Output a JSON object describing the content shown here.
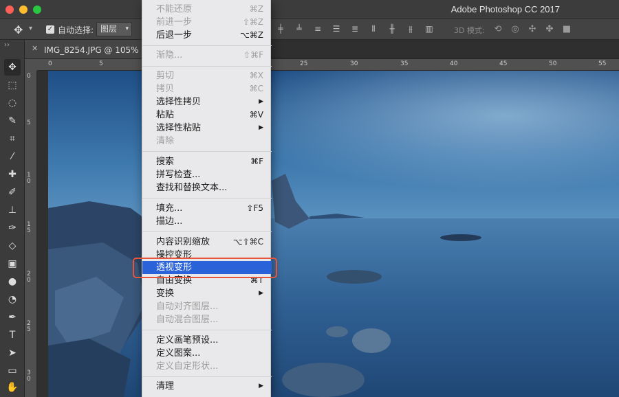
{
  "window": {
    "app_title": "Adobe Photoshop CC 2017"
  },
  "options_bar": {
    "auto_select_label": "自动选择:",
    "auto_select_target": "图层",
    "mode_3d_label": "3D 模式:"
  },
  "document": {
    "tab_name": "IMG_8254.JPG @ 105% (图"
  },
  "rulers": {
    "top_ticks": [
      "0",
      "5",
      "25",
      "30",
      "35",
      "40",
      "45",
      "50",
      "55"
    ],
    "left_ticks": [
      "0",
      "5",
      "1\n0",
      "1\n5",
      "2\n0",
      "2\n5",
      "3\n0"
    ]
  },
  "edit_menu": {
    "items": [
      {
        "label": "不能还原",
        "shortcut": "⌘Z",
        "disabled": true
      },
      {
        "label": "前进一步",
        "shortcut": "⇧⌘Z",
        "disabled": true
      },
      {
        "label": "后退一步",
        "shortcut": "⌥⌘Z",
        "disabled": false
      },
      {
        "label": "渐隐...",
        "shortcut": "⇧⌘F",
        "disabled": true
      },
      {
        "label": "剪切",
        "shortcut": "⌘X",
        "disabled": true
      },
      {
        "label": "拷贝",
        "shortcut": "⌘C",
        "disabled": true
      },
      {
        "label": "选择性拷贝",
        "shortcut": "▶",
        "disabled": false
      },
      {
        "label": "粘贴",
        "shortcut": "⌘V",
        "disabled": false
      },
      {
        "label": "选择性粘贴",
        "shortcut": "▶",
        "disabled": false
      },
      {
        "label": "清除",
        "shortcut": "",
        "disabled": true
      },
      {
        "label": "搜索",
        "shortcut": "⌘F",
        "disabled": false
      },
      {
        "label": "拼写检查...",
        "shortcut": "",
        "disabled": false
      },
      {
        "label": "查找和替换文本...",
        "shortcut": "",
        "disabled": false
      },
      {
        "label": "填充...",
        "shortcut": "⇧F5",
        "disabled": false
      },
      {
        "label": "描边...",
        "shortcut": "",
        "disabled": false
      },
      {
        "label": "内容识别缩放",
        "shortcut": "⌥⇧⌘C",
        "disabled": false
      },
      {
        "label": "操控变形",
        "shortcut": "",
        "disabled": false
      },
      {
        "label": "透视变形",
        "shortcut": "",
        "disabled": false,
        "highlighted": true
      },
      {
        "label": "自由变换",
        "shortcut": "⌘T",
        "disabled": false
      },
      {
        "label": "变换",
        "shortcut": "▶",
        "disabled": false
      },
      {
        "label": "自动对齐图层...",
        "shortcut": "",
        "disabled": true
      },
      {
        "label": "自动混合图层...",
        "shortcut": "",
        "disabled": true
      },
      {
        "label": "定义画笔预设...",
        "shortcut": "",
        "disabled": false
      },
      {
        "label": "定义图案...",
        "shortcut": "",
        "disabled": false
      },
      {
        "label": "定义自定形状...",
        "shortcut": "",
        "disabled": true
      },
      {
        "label": "清理",
        "shortcut": "▶",
        "disabled": false
      }
    ]
  },
  "colors": {
    "menu_highlight": "#2a63d9",
    "annotation_box": "#e8553b"
  }
}
